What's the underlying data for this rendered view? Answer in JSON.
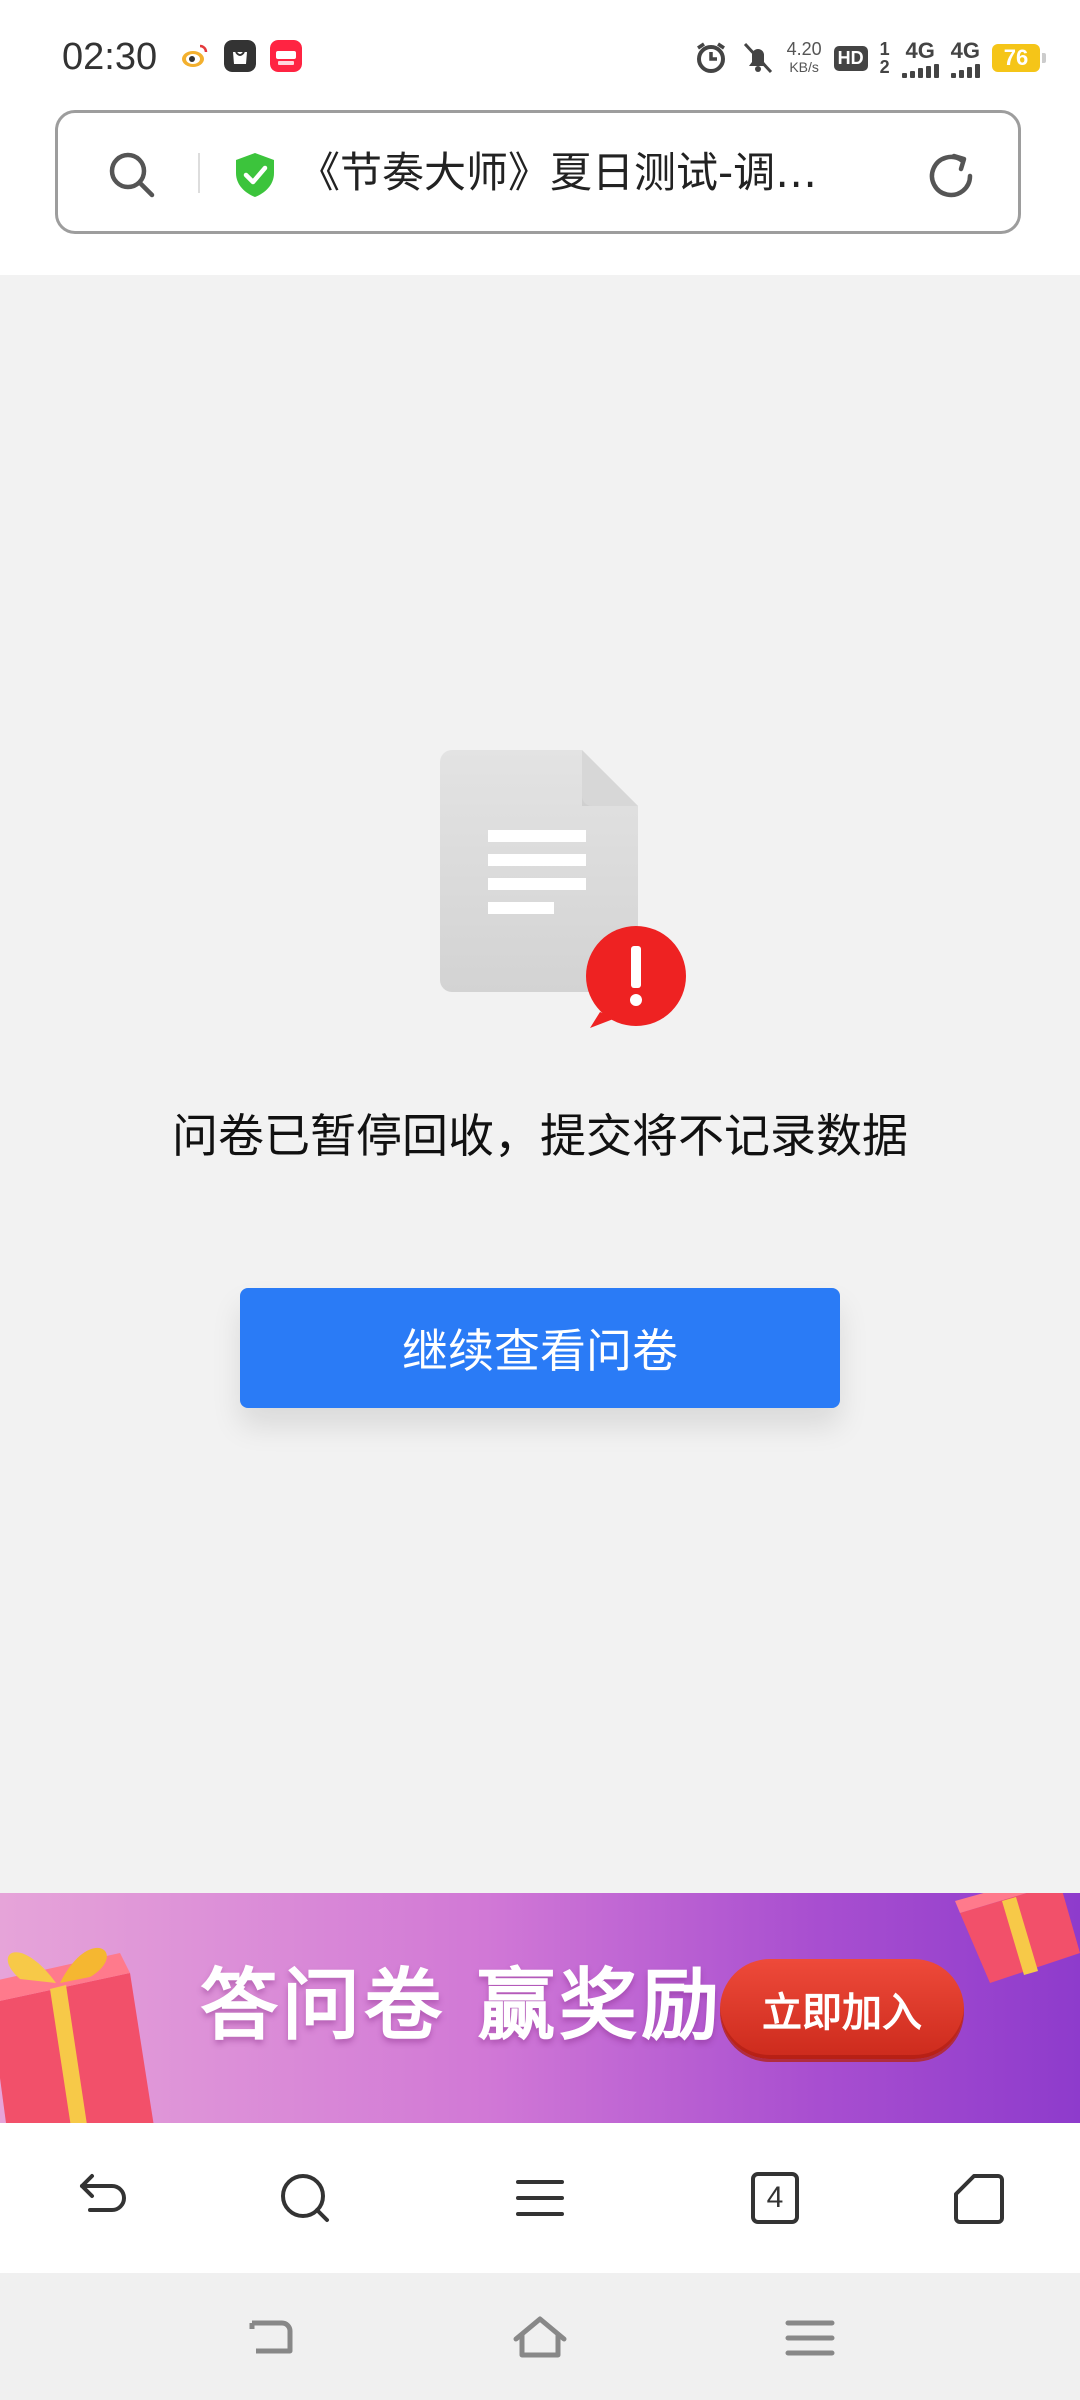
{
  "status_bar": {
    "time": "02:30",
    "speed_value": "4.20",
    "speed_unit": "KB/s",
    "hd_label": "HD",
    "sim1": "1",
    "sim2": "2",
    "net1": "4G",
    "net2": "4G",
    "battery": "76",
    "icons": [
      "weibo-icon",
      "shopping-bag-icon",
      "xiaohongshu-icon",
      "alarm-icon",
      "mute-bell-icon"
    ]
  },
  "url_bar": {
    "title": "《节奏大师》夏日测试-调…",
    "secure_color": "#3cc43c"
  },
  "main": {
    "message": "问卷已暂停回收，提交将不记录数据",
    "continue_button": "继续查看问卷"
  },
  "banner": {
    "text": "答问卷  赢奖励",
    "button": "立即加入"
  },
  "toolbar": {
    "tab_count": "4"
  },
  "colors": {
    "accent": "#2a7bf6",
    "error": "#ee2222",
    "banner_button": "#dc3524"
  }
}
